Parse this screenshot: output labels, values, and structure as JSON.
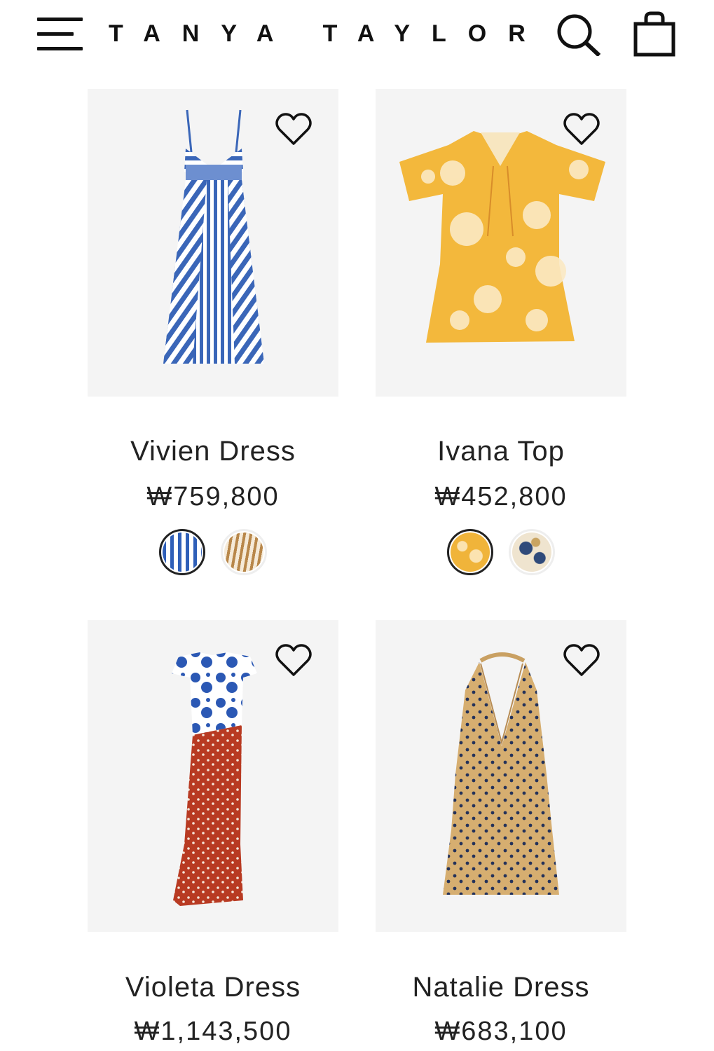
{
  "header": {
    "brand": "TANYA TAYLOR",
    "menu_icon": "hamburger-menu-icon",
    "search_icon": "search-icon",
    "bag_icon": "shopping-bag-icon"
  },
  "products": [
    {
      "name": "Vivien Dress",
      "price": "₩759,800",
      "swatches": [
        {
          "name": "blue-white-stripe",
          "color": "#2f5fb8",
          "selected": true
        },
        {
          "name": "tan-white-stripe",
          "color": "#b8874a",
          "selected": false
        }
      ]
    },
    {
      "name": "Ivana Top",
      "price": "₩452,800",
      "swatches": [
        {
          "name": "yellow-floral",
          "color": "#f0b43a",
          "selected": true
        },
        {
          "name": "navy-cream-floral",
          "color": "#2f4a7a",
          "selected": false
        }
      ]
    },
    {
      "name": "Violeta Dress",
      "price": "₩1,143,500",
      "swatches": []
    },
    {
      "name": "Natalie Dress",
      "price": "₩683,100",
      "swatches": []
    }
  ],
  "colors": {
    "image_bg": "#f4f4f4",
    "text": "#222222",
    "stripe_blue": "#3a66b8",
    "floral_yellow": "#f3b83c",
    "dot_red": "#b83a22",
    "floral_blue": "#2b58b4",
    "tan": "#d6ae70",
    "dot_navy": "#24325a"
  }
}
